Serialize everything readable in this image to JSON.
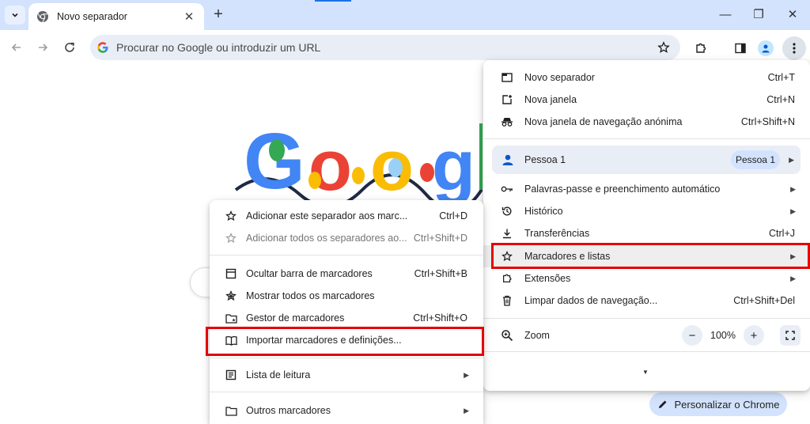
{
  "tab": {
    "title": "Novo separador",
    "close": "✕"
  },
  "toolbar": {
    "new_tab": "+",
    "omnibox_placeholder": "Procurar no Google ou introduzir um URL"
  },
  "window": {
    "minimize": "—",
    "restore": "❐",
    "close": "✕"
  },
  "main_menu": {
    "items": [
      {
        "label": "Novo separador",
        "shortcut": "Ctrl+T"
      },
      {
        "label": "Nova janela",
        "shortcut": "Ctrl+N"
      },
      {
        "label": "Nova janela de navegação anónima",
        "shortcut": "Ctrl+Shift+N"
      }
    ],
    "profile": {
      "label": "Pessoa 1",
      "chip": "Pessoa 1"
    },
    "items2": [
      {
        "label": "Palavras-passe e preenchimento automático"
      },
      {
        "label": "Histórico"
      },
      {
        "label": "Transferências",
        "shortcut": "Ctrl+J"
      },
      {
        "label": "Marcadores e listas"
      },
      {
        "label": "Extensões"
      },
      {
        "label": "Limpar dados de navegação...",
        "shortcut": "Ctrl+Shift+Del"
      }
    ],
    "zoom": {
      "label": "Zoom",
      "minus": "−",
      "value": "100%",
      "plus": "+"
    }
  },
  "bookmarks_menu": {
    "items": [
      {
        "label": "Adicionar este separador aos marc...",
        "shortcut": "Ctrl+D"
      },
      {
        "label": "Adicionar todos os separadores ao...",
        "shortcut": "Ctrl+Shift+D"
      },
      {
        "label": "Ocultar barra de marcadores",
        "shortcut": "Ctrl+Shift+B"
      },
      {
        "label": "Mostrar todos os marcadores"
      },
      {
        "label": "Gestor de marcadores",
        "shortcut": "Ctrl+Shift+O"
      },
      {
        "label": "Importar marcadores e definições..."
      },
      {
        "label": "Lista de leitura"
      },
      {
        "label": "Outros marcadores"
      }
    ]
  },
  "page": {
    "customize_label": "Personalizar o Chrome"
  },
  "colors": {
    "highlight": "#e60000",
    "accent": "#1a73e8",
    "tabstrip": "#d3e3fd"
  }
}
